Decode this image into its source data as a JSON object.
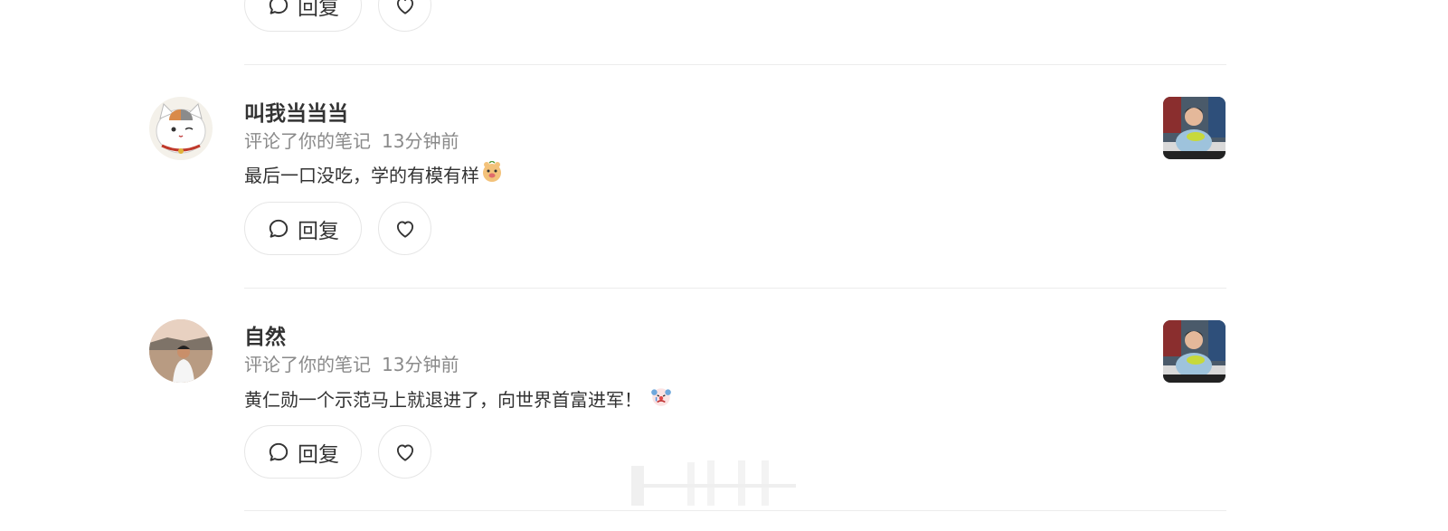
{
  "comments": [
    {
      "username": "叫我当当当",
      "action": "评论了你的笔记",
      "time": "13分钟前",
      "text": "最后一口没吃，学的有模有样",
      "emoji": "hamster-emoji",
      "avatar": "cat-avatar",
      "reply_label": "回复"
    },
    {
      "username": "自然",
      "action": "评论了你的笔记",
      "time": "13分钟前",
      "text": "黄仁勋一个示范马上就退进了，向世界首富进军！",
      "emoji": "clown-crying-emoji",
      "avatar": "man-outdoor-avatar",
      "reply_label": "回复"
    }
  ],
  "top_partial": {
    "reply_label": "回复"
  },
  "colors": {
    "accent_text": "#333333",
    "muted_text": "#8a8a8a",
    "border": "#e6e6e6",
    "divider": "#ececec"
  },
  "icons": [
    "comment-bubble-icon",
    "heart-icon"
  ]
}
